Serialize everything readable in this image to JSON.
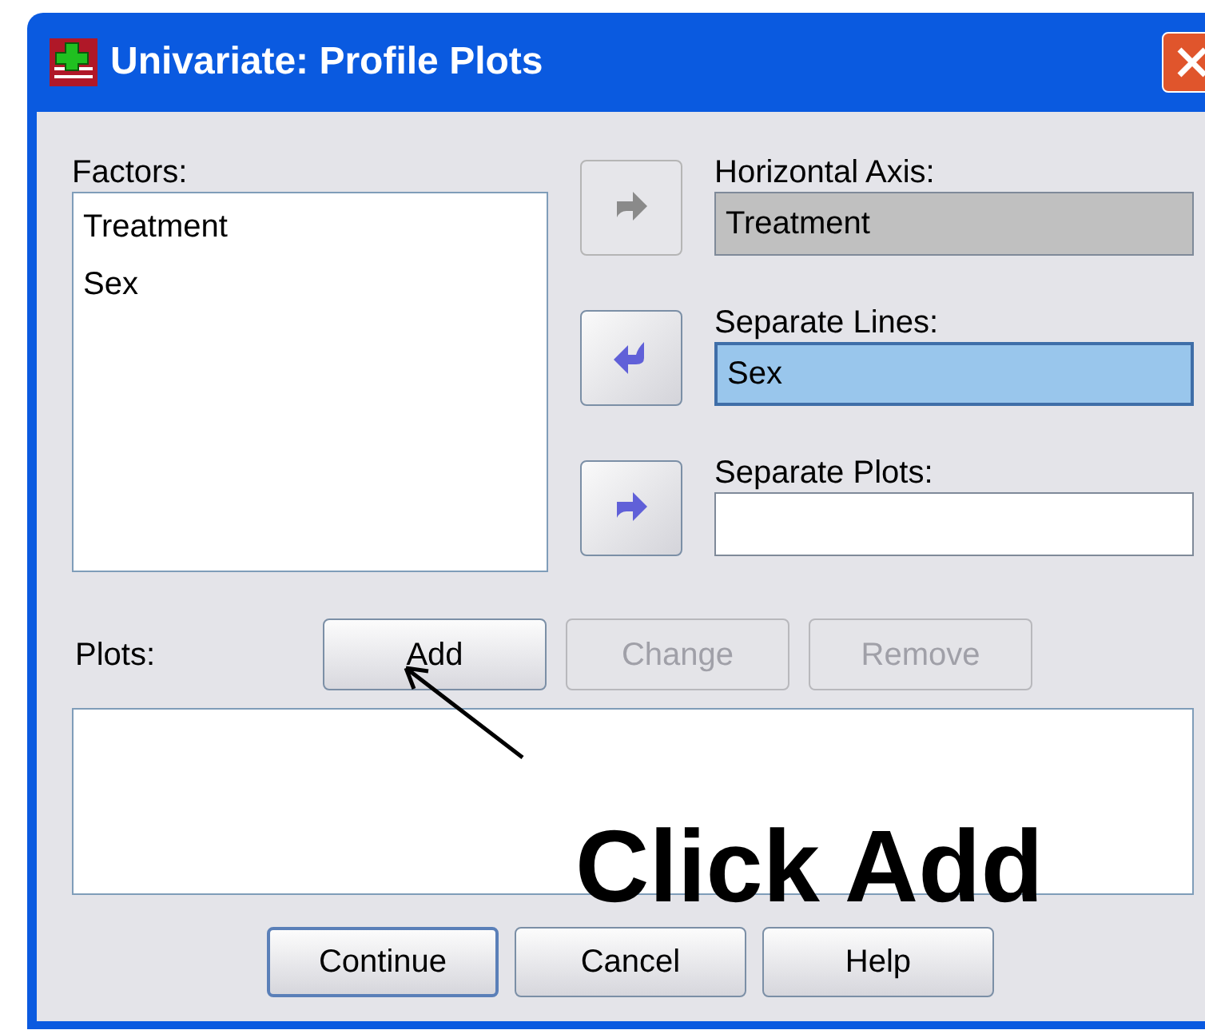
{
  "window": {
    "title": "Univariate: Profile Plots"
  },
  "factors": {
    "label": "Factors:",
    "items": [
      "Treatment",
      "Sex"
    ]
  },
  "move_buttons": [
    {
      "kind": "right",
      "disabled": true
    },
    {
      "kind": "left",
      "disabled": false
    },
    {
      "kind": "right",
      "disabled": false
    }
  ],
  "targets": [
    {
      "label": "Horizontal Axis:",
      "value": "Treatment",
      "disabled": true,
      "selected": false
    },
    {
      "label": "Separate Lines:",
      "value": "Sex",
      "disabled": false,
      "selected": true
    },
    {
      "label": "Separate Plots:",
      "disabled": false,
      "selected": false
    }
  ],
  "plots": {
    "label": "Plots:",
    "buttons": [
      {
        "label": "Add",
        "disabled": false
      },
      {
        "label": "Change",
        "disabled": true
      },
      {
        "label": "Remove",
        "disabled": true
      }
    ]
  },
  "buttons": [
    {
      "label": "Continue",
      "default": true
    },
    {
      "label": "Cancel",
      "default": false
    },
    {
      "label": "Help",
      "default": false
    }
  ],
  "annotation": {
    "text": "Click Add"
  }
}
